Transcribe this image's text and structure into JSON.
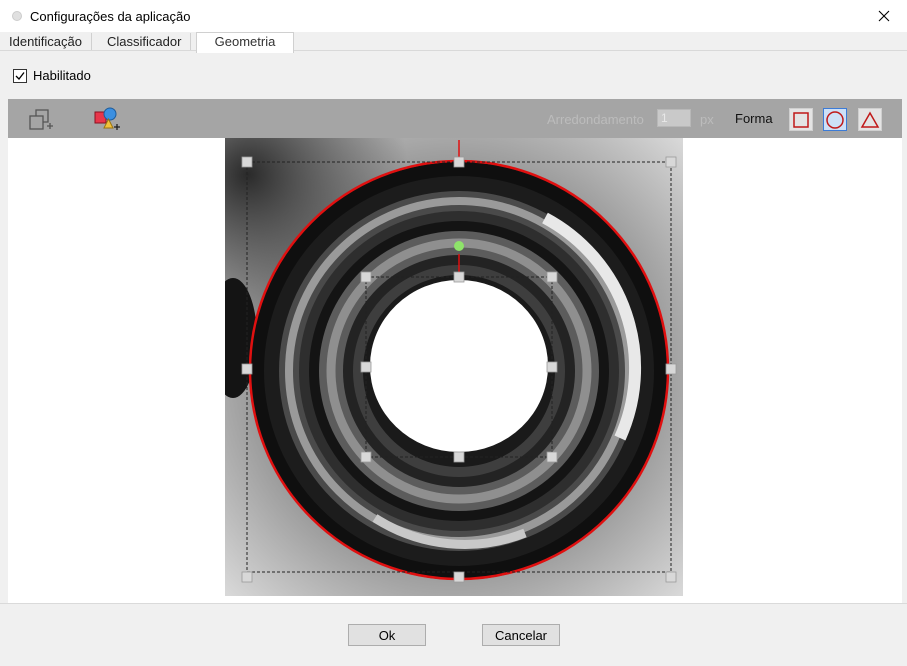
{
  "window": {
    "title": "Configurações da aplicação"
  },
  "tabs": [
    {
      "label": "Identificação"
    },
    {
      "label": "Classificador"
    },
    {
      "label": "Geometria",
      "active": true
    }
  ],
  "enabled": {
    "label": "Habilitado",
    "checked": true
  },
  "toolbar": {
    "rounding_label": "Arredondamento",
    "rounding_value": "1",
    "rounding_unit": "px",
    "shape_label": "Forma",
    "shapes": [
      "square",
      "circle",
      "triangle"
    ],
    "selected_shape": "circle",
    "icons": [
      "add-shape-icon",
      "add-shapes-icon"
    ]
  },
  "colors": {
    "roi_circle": "#e01010",
    "rotate_handle": "#8ee36a",
    "toolbar_bg": "#a5a5a5",
    "shape_icon": "#c01818"
  },
  "buttons": {
    "ok": "Ok",
    "cancel": "Cancelar"
  }
}
